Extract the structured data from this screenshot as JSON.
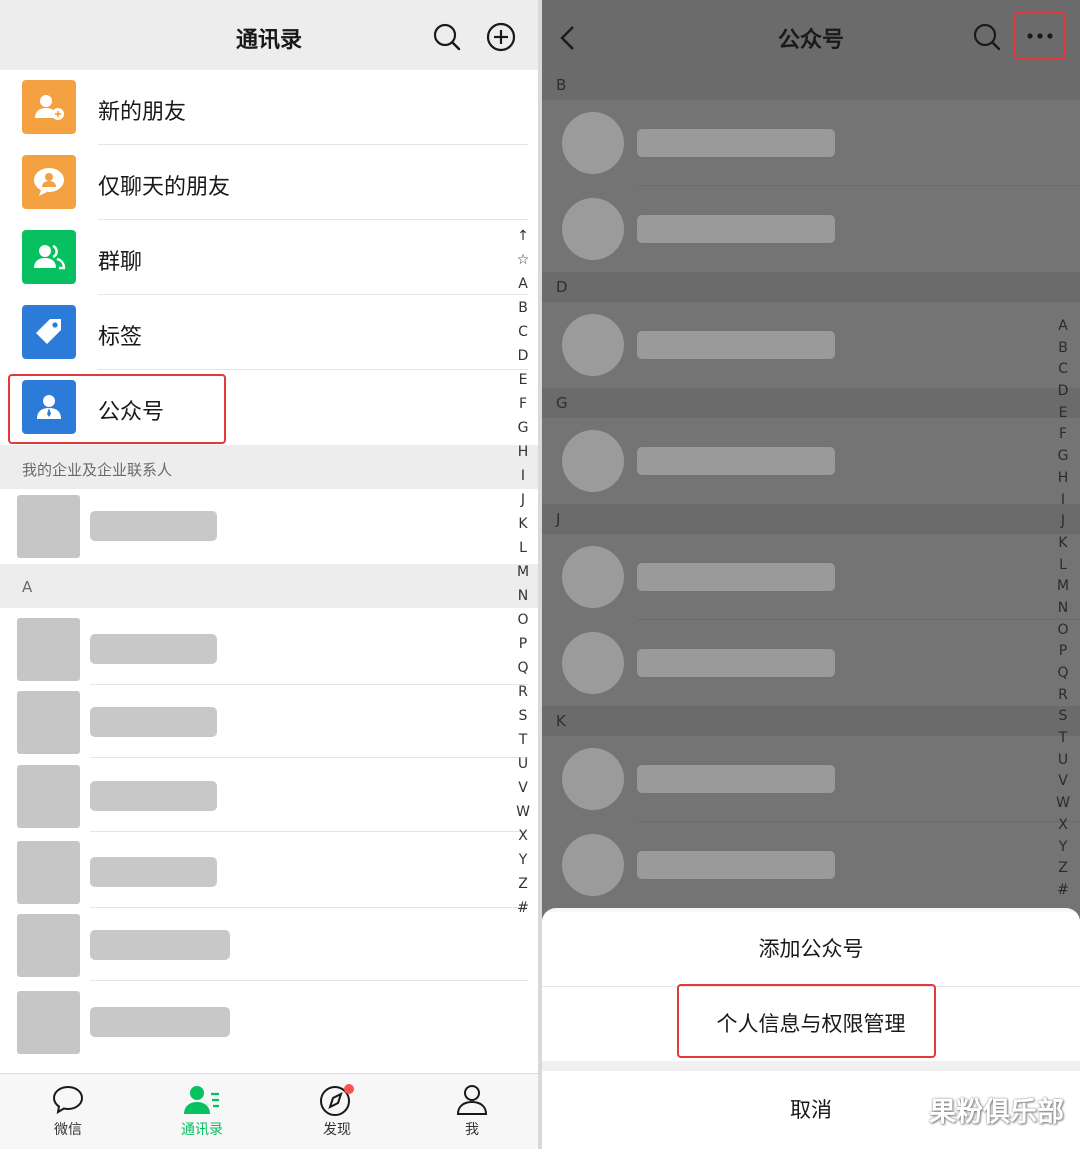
{
  "left": {
    "header": {
      "title": "通讯录"
    },
    "menu": [
      {
        "label": "新的朋友",
        "color": "#f4a141",
        "icon": "add-friend-icon"
      },
      {
        "label": "仅聊天的朋友",
        "color": "#f4a141",
        "icon": "chat-only-friend-icon"
      },
      {
        "label": "群聊",
        "color": "#07c160",
        "icon": "group-chat-icon"
      },
      {
        "label": "标签",
        "color": "#2d7bd8",
        "icon": "tag-icon"
      },
      {
        "label": "公众号",
        "color": "#2d7bd8",
        "icon": "official-account-icon"
      }
    ],
    "enterprise_section": "我的企业及企业联系人",
    "section_a": "A",
    "index": [
      "↑",
      "☆",
      "A",
      "B",
      "C",
      "D",
      "E",
      "F",
      "G",
      "H",
      "I",
      "J",
      "K",
      "L",
      "M",
      "N",
      "O",
      "P",
      "Q",
      "R",
      "S",
      "T",
      "U",
      "V",
      "W",
      "X",
      "Y",
      "Z",
      "#"
    ],
    "tabs": [
      {
        "label": "微信",
        "icon": "chat-bubble-icon"
      },
      {
        "label": "通讯录",
        "icon": "contacts-icon"
      },
      {
        "label": "发现",
        "icon": "compass-icon"
      },
      {
        "label": "我",
        "icon": "person-icon"
      }
    ]
  },
  "right": {
    "header": {
      "title": "公众号"
    },
    "sections": [
      "B",
      "D",
      "G",
      "J",
      "K"
    ],
    "index": [
      "A",
      "B",
      "C",
      "D",
      "E",
      "F",
      "G",
      "H",
      "I",
      "J",
      "K",
      "L",
      "M",
      "N",
      "O",
      "P",
      "Q",
      "R",
      "S",
      "T",
      "U",
      "V",
      "W",
      "X",
      "Y",
      "Z",
      "#"
    ],
    "sheet": {
      "add": "添加公众号",
      "privacy": "个人信息与权限管理",
      "cancel": "取消"
    }
  },
  "watermark": "果粉俱乐部",
  "colors": {
    "accent": "#07c160",
    "highlight": "#e3393c",
    "badge": "#fa5151"
  }
}
